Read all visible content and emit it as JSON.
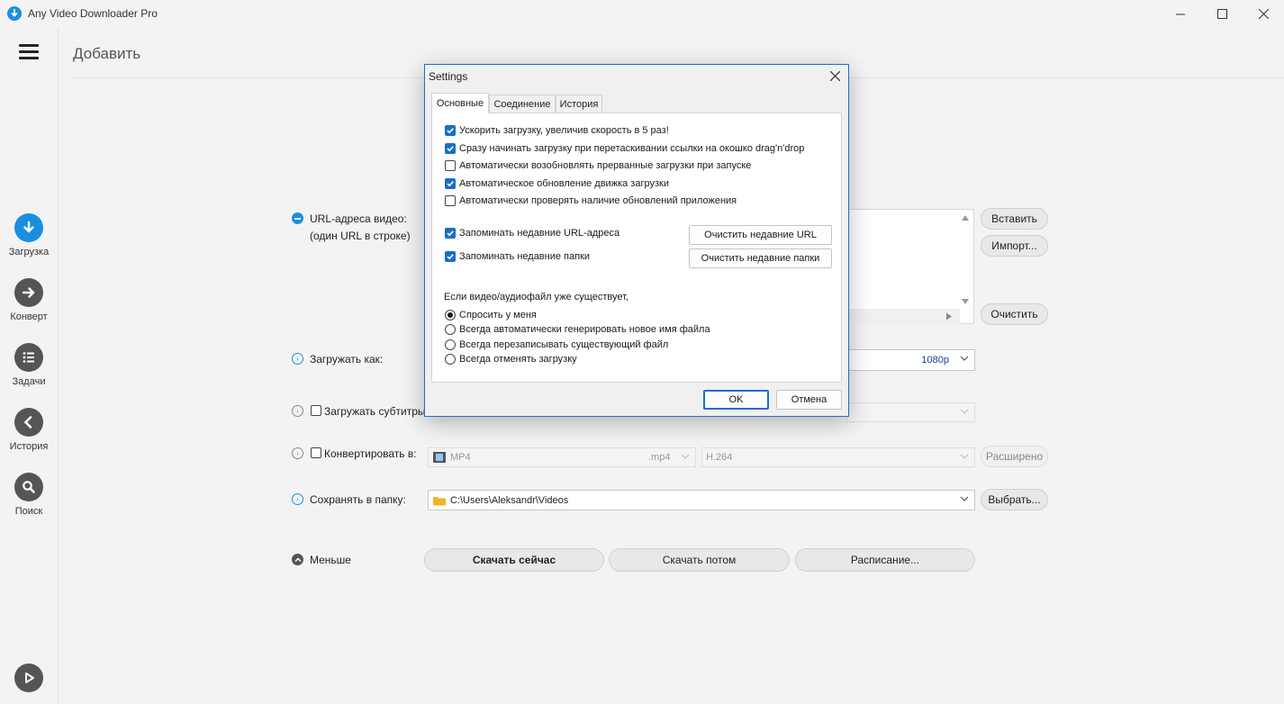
{
  "window": {
    "title": "Any Video Downloader Pro"
  },
  "sidebar": {
    "items": [
      {
        "label": "Загрузка",
        "icon": "download-arrow-icon"
      },
      {
        "label": "Конверт",
        "icon": "arrow-right-icon"
      },
      {
        "label": "Задачи",
        "icon": "list-icon"
      },
      {
        "label": "История",
        "icon": "arrow-left-icon"
      },
      {
        "label": "Поиск",
        "icon": "search-icon"
      }
    ]
  },
  "main": {
    "title": "Добавить",
    "url_label": "URL-адреса видео:",
    "url_sublabel": "(один URL в строке)",
    "paste_label": "Вставить",
    "import_label": "Импорт...",
    "clear_label": "Очистить",
    "download_as_label": "Загружать как:",
    "quality_value": "1080p",
    "subtitles_label": "Загружать субтитры:",
    "convert_label": "Конвертировать в:",
    "format_value": "MP4",
    "format_ext": ".mp4",
    "codec_value": "H.264",
    "advanced_label": "Расширено",
    "save_folder_label": "Сохранять в папку:",
    "folder_value": "C:\\Users\\Aleksandr\\Videos",
    "browse_label": "Выбрать...",
    "less_label": "Меньше",
    "download_now_label": "Скачать сейчас",
    "download_later_label": "Скачать потом",
    "schedule_label": "Расписание..."
  },
  "dialog": {
    "title": "Settings",
    "tabs": [
      "Основные",
      "Соединение",
      "История"
    ],
    "checkboxes": [
      {
        "label": "Ускорить загрузку, увеличив скорость в 5 раз!",
        "checked": true
      },
      {
        "label": "Сразу начинать загрузку при перетаскивании ссылки на окошко drag'n'drop",
        "checked": true
      },
      {
        "label": "Автоматически возобновлять прерванные загрузки при запуске",
        "checked": false
      },
      {
        "label": "Автоматическое обновление движка загрузки",
        "checked": true
      },
      {
        "label": "Автоматически проверять наличие обновлений приложения",
        "checked": false
      }
    ],
    "remember_urls_label": "Запоминать недавние URL-адреса",
    "clear_urls_label": "Очистить недавние URL",
    "remember_folders_label": "Запоминать недавние папки",
    "clear_folders_label": "Очистить недавние папки",
    "exists_heading": "Если видео/аудиофайл уже существует,",
    "radios": [
      {
        "label": "Спросить у меня",
        "selected": true
      },
      {
        "label": "Всегда автоматически генерировать новое имя файла",
        "selected": false
      },
      {
        "label": "Всегда перезаписывать существующий файл",
        "selected": false
      },
      {
        "label": "Всегда отменять загрузку",
        "selected": false
      }
    ],
    "ok_label": "OK",
    "cancel_label": "Отмена"
  },
  "colors": {
    "accent": "#1a8fe0",
    "checkbox": "#1a6fc4",
    "nav_icon": "#555555"
  }
}
